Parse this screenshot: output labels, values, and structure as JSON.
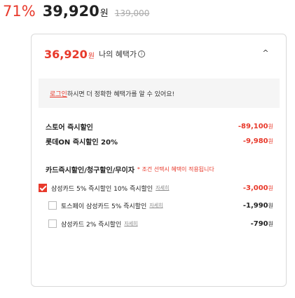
{
  "price": {
    "discount_rate": "71%",
    "sale_price": "39,920",
    "won": "원",
    "original_price": "139,000"
  },
  "panel": {
    "my_price": "36,920",
    "my_price_unit": "원",
    "my_benefit_label": "나의 혜택가",
    "info_icon_glyph": "i",
    "collapse_icon_glyph": "^",
    "member_banner": {
      "login_text": "로그인",
      "rest_text": " 하시면 더 정확한 혜택가를 알 수 있어요!"
    },
    "discounts": [
      {
        "label": "스토어 즉시할인",
        "amount": "-89,100",
        "unit": "원"
      },
      {
        "label": "롯데ON 즉시할인 20%",
        "amount": "-9,980",
        "unit": "원"
      }
    ],
    "card_section": {
      "title": "카드즉시할인/청구할인/무이자",
      "note": "* 조건 선택시 혜택이 적용됩니다"
    },
    "card_options": [
      {
        "label": "삼성카드 5% 즉시할인 10% 즉시할인",
        "detail": "자세히",
        "amount": "-3,000",
        "unit": "원",
        "checked": true
      },
      {
        "label": "토스페이 삼성카드 5% 즉시할인",
        "detail": "자세히",
        "amount": "-1,990",
        "unit": "원",
        "checked": false
      },
      {
        "label": "삼성카드 2% 즉시할인",
        "detail": "자세히",
        "amount": "-790",
        "unit": "원",
        "checked": false
      }
    ]
  },
  "colors": {
    "accent": "#e8392b",
    "border": "#d9d9d9",
    "banner_bg": "#f5f5f5"
  }
}
